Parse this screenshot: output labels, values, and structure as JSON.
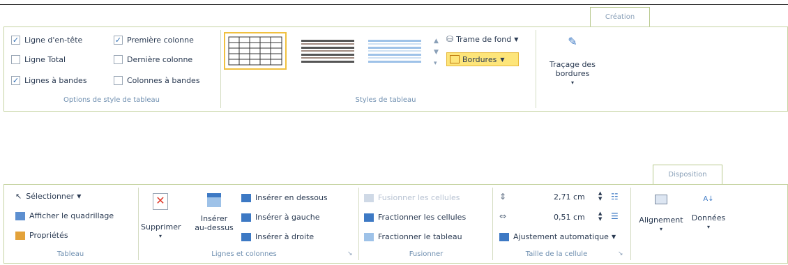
{
  "top": {
    "tab_label": "Création",
    "groups": {
      "options_label": "Options de style de tableau",
      "styles_label": "Styles de tableau"
    },
    "checkboxes": [
      {
        "label": "Ligne d'en-tête",
        "checked": true
      },
      {
        "label": "Ligne Total",
        "checked": false
      },
      {
        "label": "Lignes à bandes",
        "checked": true
      },
      {
        "label": "Première colonne",
        "checked": true
      },
      {
        "label": "Dernière colonne",
        "checked": false
      },
      {
        "label": "Colonnes à bandes",
        "checked": false
      }
    ],
    "shading_label": "Trame de fond",
    "borders_label": "Bordures",
    "draw_borders_label_1": "Traçage des",
    "draw_borders_label_2": "bordures"
  },
  "bottom": {
    "tab_label": "Disposition",
    "groups": {
      "table_label": "Tableau",
      "rows_cols_label": "Lignes et colonnes",
      "merge_label": "Fusionner",
      "cell_size_label": "Taille de la cellule"
    },
    "table": {
      "select_label": "Sélectionner",
      "gridlines_label": "Afficher le quadrillage",
      "properties_label": "Propriétés"
    },
    "rows_cols": {
      "delete_label": "Supprimer",
      "insert_above_1": "Insérer",
      "insert_above_2": "au-dessus",
      "insert_below_label": "Insérer en dessous",
      "insert_left_label": "Insérer à gauche",
      "insert_right_label": "Insérer à droite"
    },
    "merge": {
      "merge_cells_label": "Fusionner les cellules",
      "split_cells_label": "Fractionner les cellules",
      "split_table_label": "Fractionner le tableau"
    },
    "cell_size": {
      "width_value": "2,71 cm",
      "height_value": "0,51 cm",
      "autofit_label": "Ajustement automatique"
    },
    "alignment_label": "Alignement",
    "data_label": "Données"
  },
  "colors": {
    "ribbon_border": "#c5d3a1",
    "highlight": "#fde57a",
    "label_blue": "#6f8fb0"
  }
}
